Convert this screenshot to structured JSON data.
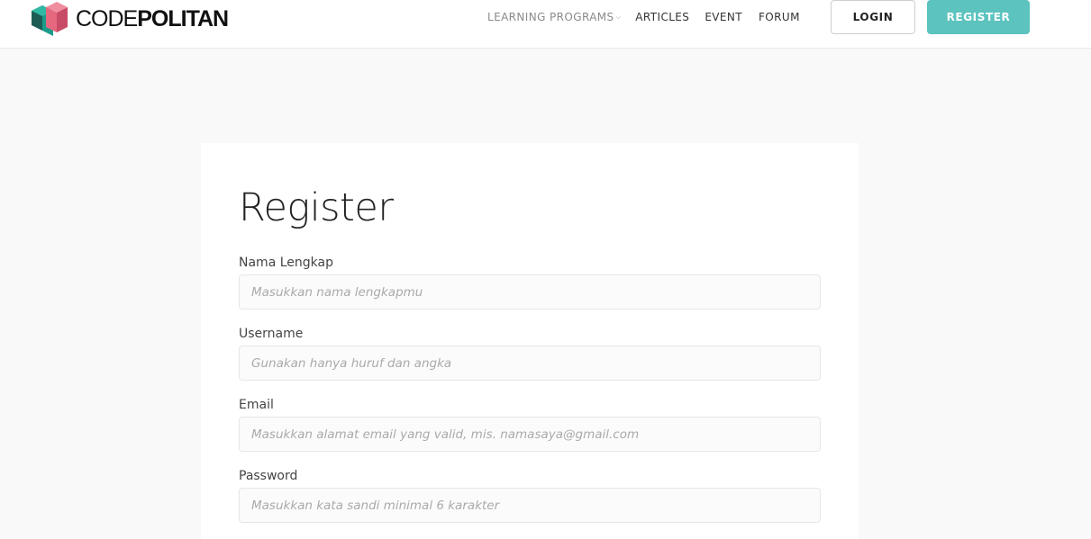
{
  "brand": {
    "name_light": "CODE",
    "name_bold": "POLITAN",
    "colors": {
      "teal": "#1b9b8a",
      "pink": "#e5687f",
      "dark": "#1d3a3a"
    }
  },
  "nav": {
    "items": [
      {
        "label": "LEARNING PROGRAMS",
        "has_dropdown": true
      },
      {
        "label": "ARTICLES"
      },
      {
        "label": "EVENT"
      },
      {
        "label": "FORUM"
      }
    ],
    "login_label": "LOGIN",
    "register_label": "REGISTER"
  },
  "form": {
    "title": "Register",
    "fields": [
      {
        "label": "Nama Lengkap",
        "placeholder": "Masukkan nama lengkapmu"
      },
      {
        "label": "Username",
        "placeholder": "Gunakan hanya huruf dan angka"
      },
      {
        "label": "Email",
        "placeholder": "Masukkan alamat email yang valid, mis. namasaya@gmail.com"
      },
      {
        "label": "Password",
        "placeholder": "Masukkan kata sandi minimal 6 karakter"
      }
    ]
  },
  "colors": {
    "accent": "#5cc3bf",
    "page_bg": "#f9f9f9"
  }
}
